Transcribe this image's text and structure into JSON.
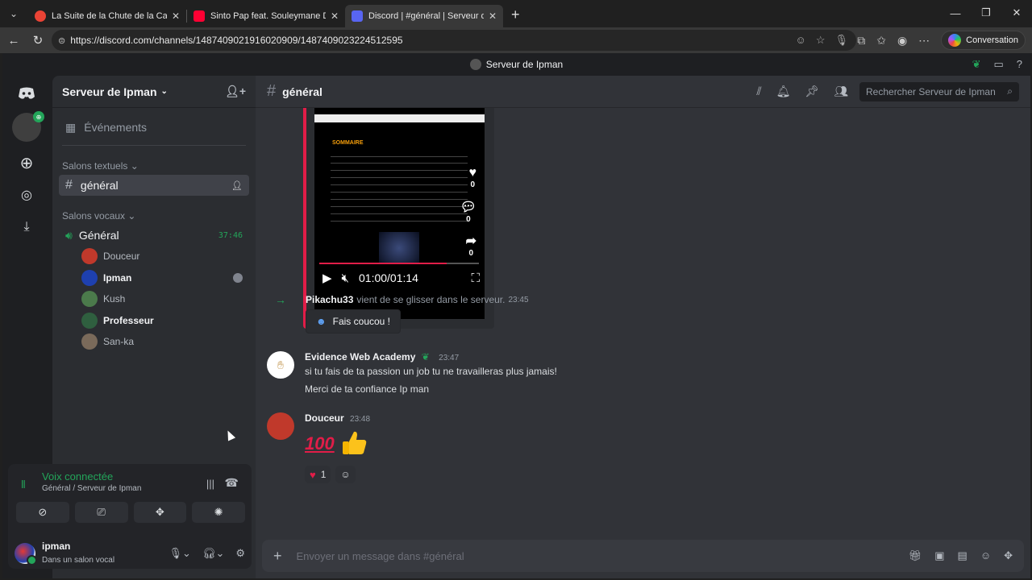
{
  "browser": {
    "tabs": [
      {
        "title": "La Suite de la Chute de la Cabale",
        "favicon_color": "#ea4335"
      },
      {
        "title": "Sinto Pap feat. Souleymane Diama",
        "favicon_color": "#ff0033"
      },
      {
        "title": "Discord | #général | Serveur de Ipman",
        "favicon_color": "#5865f2",
        "active": true
      }
    ],
    "url": "https://discord.com/channels/1487409021916020909/1487409023224512595",
    "conversation_label": "Conversation"
  },
  "app": {
    "window_title": "Serveur de Ipman"
  },
  "sidebar": {
    "server_name": "Serveur de Ipman",
    "events_label": "Événements",
    "text_category": "Salons textuels",
    "text_channel": "général",
    "voice_category": "Salons vocaux",
    "voice_channel": "Général",
    "voice_timer": "37:46",
    "voice_users": [
      {
        "name": "Douceur",
        "color": "#c0392b",
        "bold": false
      },
      {
        "name": "Ipman",
        "color": "#1e40af",
        "bold": true
      },
      {
        "name": "Kush",
        "color": "#4b7a4b",
        "bold": false
      },
      {
        "name": "Professeur",
        "color": "#2f5f3f",
        "bold": true
      },
      {
        "name": "San-ka",
        "color": "#7a6a5a",
        "bold": false
      }
    ]
  },
  "voice_panel": {
    "status": "Voix connectée",
    "location": "Général / Serveur de Ipman"
  },
  "user": {
    "name": "ipman",
    "status": "Dans un salon vocal"
  },
  "channel_header": {
    "name": "général",
    "search_placeholder": "Rechercher Serveur de Ipman"
  },
  "video": {
    "heading": "SOMMAIRE",
    "likes": "0",
    "comments": "0",
    "shares": "0",
    "time": "01:00/01:14",
    "progress": 0.8
  },
  "messages": {
    "join": {
      "user": "Pikachu33",
      "text": "vient de se glisser dans le serveur.",
      "time": "23:45",
      "wave_label": "Fais coucou !"
    },
    "evidence": {
      "user": "Evidence Web Academy",
      "time": "23:47",
      "lines": [
        "si tu fais de ta passion un job tu ne travailleras plus jamais!",
        "Merci de ta confiance Ip man"
      ]
    },
    "douceur": {
      "user": "Douceur",
      "time": "23:48",
      "emoji_text": "100",
      "reaction_count": "1"
    }
  },
  "composer": {
    "placeholder": "Envoyer un message dans #général"
  }
}
